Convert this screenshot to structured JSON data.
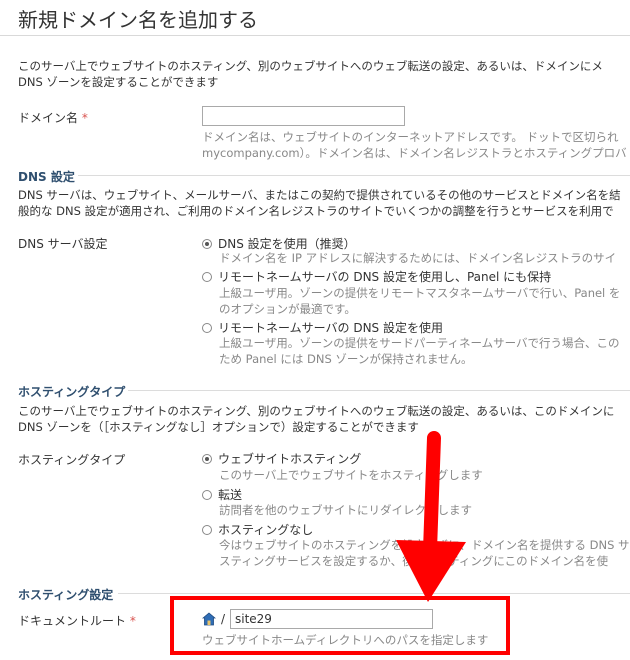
{
  "page": {
    "title": "新規ドメイン名を追加する",
    "intro_line1": "このサーバ上でウェブサイトのホスティング、別のウェブサイトへのウェブ転送の設定、あるいは、ドメインにメ",
    "intro_line2": "DNS ゾーンを設定することができます"
  },
  "domain_field": {
    "label": "ドメイン名",
    "required_mark": "*",
    "value": "",
    "hint_line1": "ドメイン名は、ウェブサイトのインターネットアドレスです。 ドットで区切られ",
    "hint_line2": "mycompany.com）。ドメイン名は、ドメイン名レジストラとホスティングプロバ"
  },
  "dns_section": {
    "heading": "DNS 設定",
    "desc_line1": "DNS サーバは、ウェブサイト、メールサーバ、またはこの契約で提供されているその他のサービスとドメイン名を結",
    "desc_line2": "般的な DNS 設定が適用され、ご利用のドメイン名レジストラのサイトでいくつかの調整を行うとサービスを利用で",
    "label": "DNS サーバ設定",
    "options": [
      {
        "label": "DNS 設定を使用（推奨）",
        "hint1": "ドメイン名を IP アドレスに解決するためには、ドメイン名レジストラのサイ",
        "hint2": "",
        "checked": true
      },
      {
        "label": "リモートネームサーバの DNS 設定を使用し、Panel にも保持",
        "hint1": "上級ユーザ用。ゾーンの提供をリモートマスタネームサーバで行い、Panel を",
        "hint2": "のオプションが最適です。",
        "checked": false
      },
      {
        "label": "リモートネームサーバの DNS 設定を使用",
        "hint1": "上級ユーザ用。ゾーンの提供をサードパーティネームサーバで行う場合、この",
        "hint2": "ため Panel には DNS ゾーンが保持されません。",
        "checked": false
      }
    ]
  },
  "hosting_section": {
    "heading": "ホスティングタイプ",
    "desc_line1": "このサーバ上でウェブサイトのホスティング、別のウェブサイトへのウェブ転送の設定、あるいは、このドメインに",
    "desc_line2": "DNS ゾーンを（［ホスティングなし］オプションで）設定することができます",
    "label": "ホスティングタイプ",
    "options": [
      {
        "label": "ウェブサイトホスティング",
        "hint1": "このサーバ上でウェブサイトをホスティングします",
        "hint2": "",
        "checked": true
      },
      {
        "label": "転送",
        "hint1": "訪問者を他のウェブサイトにリダイレクトします",
        "hint2": "",
        "checked": false
      },
      {
        "label": "ホスティングなし",
        "hint1": "今はウェブサイトのホスティングを設定せずに、ドメイン名を提供する DNS サ",
        "hint2": "スティングサービスを設定するか、後でホスティングにこのドメイン名を使",
        "checked": false
      }
    ]
  },
  "hosting_settings": {
    "heading": "ホスティング設定",
    "docroot_label": "ドキュメントルート",
    "required_mark": "*",
    "separator": "/",
    "docroot_value": "site29",
    "docroot_hint": "ウェブサイトホームディレクトリへのパスを指定します"
  },
  "colors": {
    "annotation_red": "#ff0000",
    "section_heading": "#2f4f6f",
    "home_icon_blue": "#2f6db5"
  },
  "icons": {
    "home": "home-icon",
    "annotation_arrow": "arrow-down-icon"
  }
}
